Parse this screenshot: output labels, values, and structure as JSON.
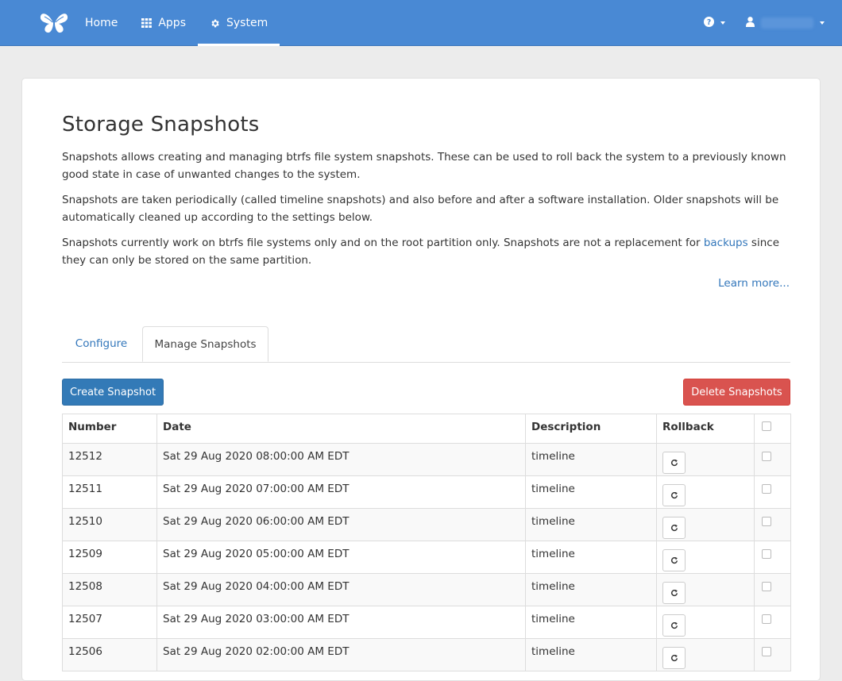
{
  "nav": {
    "items": [
      {
        "label": "Home",
        "icon": "butterfly-logo"
      },
      {
        "label": "Apps",
        "icon": "grid-icon"
      },
      {
        "label": "System",
        "icon": "gear-icon",
        "active": true
      }
    ],
    "help_icon": "question-circle-icon",
    "user_icon": "user-icon",
    "accent": "#4989d4"
  },
  "page": {
    "title": "Storage Snapshots",
    "para1": "Snapshots allows creating and managing btrfs file system snapshots. These can be used to roll back the system to a previously known good state in case of unwanted changes to the system.",
    "para2": "Snapshots are taken periodically (called timeline snapshots) and also before and after a software installation. Older snapshots will be automatically cleaned up according to the settings below.",
    "para3_before": "Snapshots currently work on btrfs file systems only and on the root partition only. Snapshots are not a replacement for ",
    "para3_link": "backups",
    "para3_after": " since they can only be stored on the same partition.",
    "learn_more": "Learn more..."
  },
  "tabs": [
    {
      "label": "Configure",
      "active": false
    },
    {
      "label": "Manage Snapshots",
      "active": true
    }
  ],
  "buttons": {
    "create": "Create Snapshot",
    "delete": "Delete Snapshots"
  },
  "table": {
    "headers": [
      "Number",
      "Date",
      "Description",
      "Rollback"
    ],
    "rows": [
      {
        "number": "12512",
        "date": "Sat 29 Aug 2020 08:00:00 AM EDT",
        "description": "timeline"
      },
      {
        "number": "12511",
        "date": "Sat 29 Aug 2020 07:00:00 AM EDT",
        "description": "timeline"
      },
      {
        "number": "12510",
        "date": "Sat 29 Aug 2020 06:00:00 AM EDT",
        "description": "timeline"
      },
      {
        "number": "12509",
        "date": "Sat 29 Aug 2020 05:00:00 AM EDT",
        "description": "timeline"
      },
      {
        "number": "12508",
        "date": "Sat 29 Aug 2020 04:00:00 AM EDT",
        "description": "timeline"
      },
      {
        "number": "12507",
        "date": "Sat 29 Aug 2020 03:00:00 AM EDT",
        "description": "timeline"
      },
      {
        "number": "12506",
        "date": "Sat 29 Aug 2020 02:00:00 AM EDT",
        "description": "timeline"
      }
    ]
  }
}
